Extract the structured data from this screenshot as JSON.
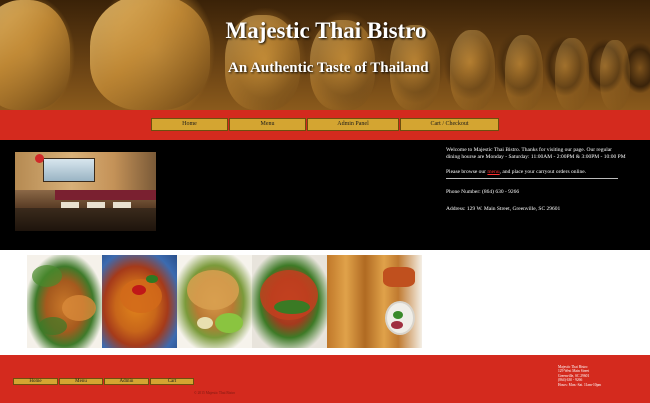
{
  "banner": {
    "title": "Majestic Thai Bistro",
    "subtitle": "An Authentic Taste of Thailand"
  },
  "nav": {
    "items": [
      {
        "label": "Home"
      },
      {
        "label": "Menu"
      },
      {
        "label": "Admin Panel"
      },
      {
        "label": "Cart / Checkout"
      }
    ]
  },
  "info": {
    "welcome": "Welcome to Majestic Thai Bistro. Thanks for visiting our page. Our regular dining hourse are Monday - Saturday: 11:00AM - 2:00PM & 3:00PM - 10:00 PM",
    "browse_prefix": "Please browse our ",
    "browse_link": "menu",
    "browse_suffix": ", and place your carryout orders online.",
    "phone": "Phone Number: (864) 630 - 9266",
    "address": "Address: 129 W. Main Street, Greenville, SC 29601"
  },
  "footer": {
    "nav": [
      {
        "label": "Home"
      },
      {
        "label": "Menu"
      },
      {
        "label": "Admin"
      },
      {
        "label": "Cart"
      }
    ],
    "contact": [
      "Majestic Thai Bistro",
      "129 West Main Street",
      "Greenville, SC 29601",
      "(864) 630 - 9266",
      "Hours: Mon.-Sat. 11am-10pm"
    ],
    "copyright": "© 2015 Majestic Thai Bistro"
  },
  "colors": {
    "red": "#d42a1e",
    "gold_button": "#d4a531",
    "black_band": "#000000",
    "link": "#ff3030"
  }
}
